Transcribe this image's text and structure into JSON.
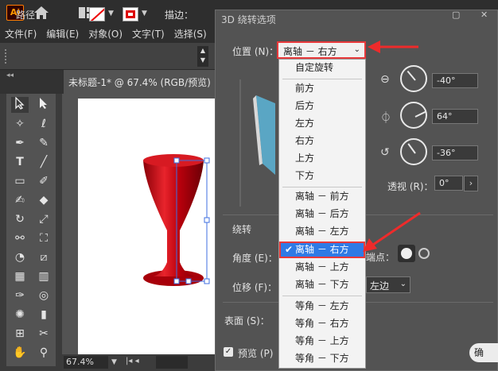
{
  "app": {
    "logo": "Ai",
    "layout_icon": "grid-layout-icon"
  },
  "menubar": {
    "items": [
      "文件(F)",
      "编辑(E)",
      "对象(O)",
      "文字(T)",
      "选择(S)"
    ]
  },
  "control_bar": {
    "object_type": "路径",
    "stroke_label": "描边："
  },
  "document_tab": {
    "title": "未标题-1* @ 67.4% (RGB/预览)"
  },
  "status_bar": {
    "zoom": "67.4%"
  },
  "dialog": {
    "title": "3D 绕转选项",
    "position_label": "位置 (N)：",
    "position_value": "离轴 － 右方",
    "rotate_x": "-40°",
    "rotate_y": "64°",
    "rotate_z": "-36°",
    "perspective_label": "透视 (R)：",
    "perspective_value": "0°",
    "revolve_label": "绕转",
    "angle_label": "角度 (E)：",
    "endcap_label": "端点：",
    "offset_label": "位移 (F)：",
    "offset_from_value": "左边",
    "surface_label": "表面 (S)：",
    "preview_label": "预览 (P)",
    "ok_label": "确"
  },
  "dropdown": {
    "options": [
      "自定旋转",
      "前方",
      "后方",
      "左方",
      "右方",
      "上方",
      "下方",
      "离轴 － 前方",
      "离轴 － 后方",
      "离轴 － 左方",
      "离轴 － 右方",
      "离轴 － 上方",
      "离轴 － 下方",
      "等角 － 左方",
      "等角 － 右方",
      "等角 － 上方",
      "等角 － 下方"
    ],
    "selected_index": 10
  },
  "colors": {
    "accent_red": "#e8393b",
    "selection_blue": "#2f7ae5",
    "cube_face": "#5aa6c4",
    "goblet_red": "#c8101a"
  }
}
